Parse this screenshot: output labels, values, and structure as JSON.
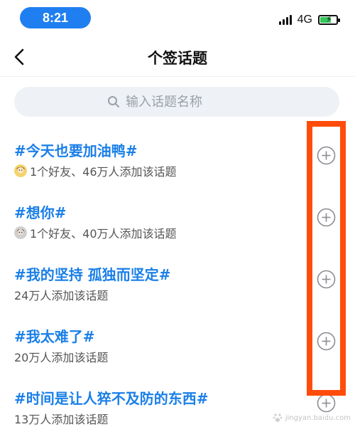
{
  "status_bar": {
    "time": "8:21",
    "network": "4G",
    "battery_level": 0.62
  },
  "header": {
    "title": "个签话题",
    "back_icon": "chevron-left-icon"
  },
  "search": {
    "placeholder": "输入话题名称",
    "icon": "search-icon"
  },
  "topics": [
    {
      "title": "#今天也要加油鸭#",
      "meta": "1个好友、46万人添加该话题",
      "has_avatar": true
    },
    {
      "title": "#想你#",
      "meta": "1个好友、40万人添加该话题",
      "has_avatar": true
    },
    {
      "title": "#我的坚持 孤独而坚定#",
      "meta": "24万人添加该话题",
      "has_avatar": false
    },
    {
      "title": "#我太难了#",
      "meta": "20万人添加该话题",
      "has_avatar": false
    },
    {
      "title": "#时间是让人猝不及防的东西#",
      "meta": "13万人添加该话题",
      "has_avatar": false
    }
  ],
  "colors": {
    "accent": "#1a7fe8",
    "time_pill": "#1f7ff0",
    "highlight": "#ff4c0a",
    "battery": "#35c759"
  },
  "watermark": {
    "text": "jingyan.baidu.com"
  }
}
